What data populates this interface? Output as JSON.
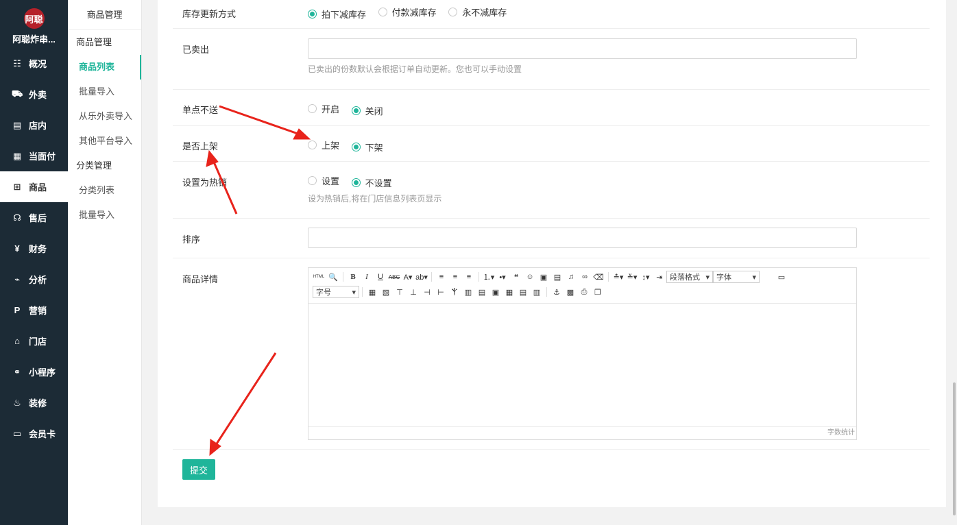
{
  "sidebar": {
    "brand_logo_text": "阿聪",
    "brand_name": "阿聪炸串...",
    "items": [
      {
        "label": "概况",
        "icon": "overview-icon"
      },
      {
        "label": "外卖",
        "icon": "delivery-icon"
      },
      {
        "label": "店内",
        "icon": "store-icon"
      },
      {
        "label": "当面付",
        "icon": "pay-icon"
      },
      {
        "label": "商品",
        "icon": "goods-icon"
      },
      {
        "label": "售后",
        "icon": "aftersale-icon"
      },
      {
        "label": "财务",
        "icon": "finance-icon"
      },
      {
        "label": "分析",
        "icon": "analysis-icon"
      },
      {
        "label": "营销",
        "icon": "marketing-icon"
      },
      {
        "label": "门店",
        "icon": "shop-icon"
      },
      {
        "label": "小程序",
        "icon": "miniprogram-icon"
      },
      {
        "label": "装修",
        "icon": "decoration-icon"
      },
      {
        "label": "会员卡",
        "icon": "membercard-icon"
      }
    ]
  },
  "subnav": {
    "title": "商品管理",
    "group1": "商品管理",
    "items1": [
      "商品列表",
      "批量导入",
      "从乐外卖导入",
      "其他平台导入"
    ],
    "group2": "分类管理",
    "items2": [
      "分类列表",
      "批量导入"
    ]
  },
  "form": {
    "stock_update": {
      "label": "库存更新方式",
      "options": [
        "拍下减库存",
        "付款减库存",
        "永不减库存"
      ]
    },
    "sold": {
      "label": "已卖出",
      "value": "",
      "help": "已卖出的份数默认会根据订单自动更新。您也可以手动设置"
    },
    "single_no_delivery": {
      "label": "单点不送",
      "options": [
        "开启",
        "关闭"
      ]
    },
    "on_shelf": {
      "label": "是否上架",
      "options": [
        "上架",
        "下架"
      ]
    },
    "hot": {
      "label": "设置为热销",
      "options": [
        "设置",
        "不设置"
      ],
      "help": "设为热销后,将在门店信息列表页显示"
    },
    "sort": {
      "label": "排序",
      "value": ""
    },
    "detail": {
      "label": "商品详情"
    }
  },
  "editor": {
    "html_label": "HTML",
    "paragraph_format": "段落格式",
    "font_family": "字体",
    "font_size": "字号",
    "word_count": "字数统计"
  },
  "submit_label": "提交",
  "colors": {
    "accent": "#1fb59a",
    "sidebar": "#1c2b36",
    "arrow": "#e8231b"
  }
}
